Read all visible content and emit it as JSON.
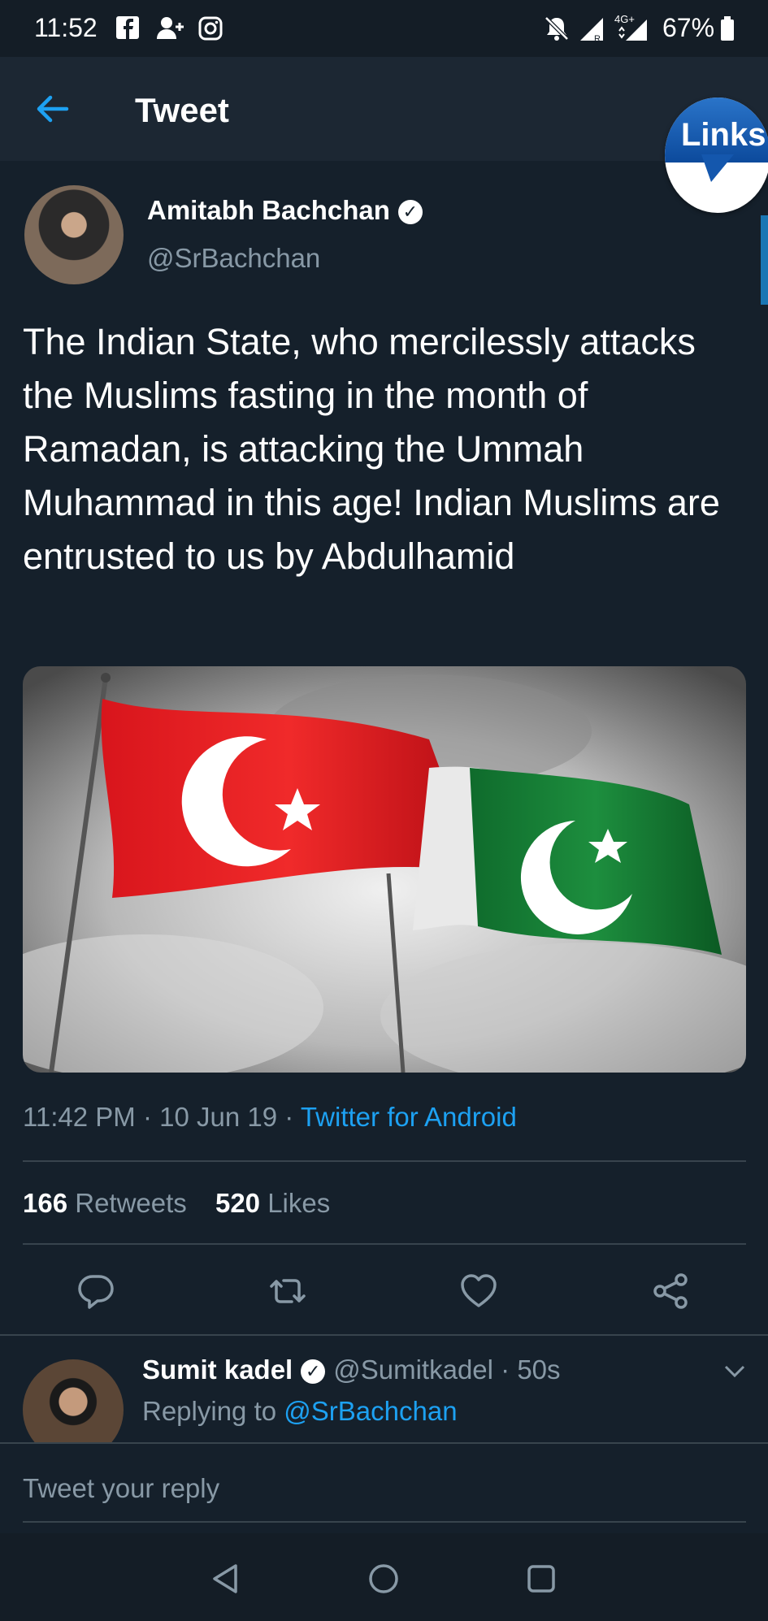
{
  "status_bar": {
    "time": "11:52",
    "network": "4G+",
    "battery": "67%"
  },
  "header": {
    "title": "Tweet",
    "links_badge": "Links"
  },
  "tweet": {
    "author_name": "Amitabh Bachchan",
    "author_handle": "@SrBachchan",
    "text": "The Indian State, who mercilessly attacks the Muslims fasting in the month of Ramadan, is attacking the Ummah Muhammad in this age! Indian Muslims are entrusted to us by Abdulhamid",
    "time": "11:42 PM",
    "date": "10 Jun 19",
    "source": "Twitter for Android",
    "retweets_count": "166",
    "retweets_label": "Retweets",
    "likes_count": "520",
    "likes_label": "Likes"
  },
  "reply": {
    "author_name": "Sumit kadel",
    "author_handle": "@Sumitkadel",
    "age": "50s",
    "replying_prefix": "Replying to",
    "replying_to": "@SrBachchan"
  },
  "compose": {
    "placeholder": "Tweet your reply"
  },
  "colors": {
    "background": "#15202b",
    "accent": "#1da1f2",
    "muted_text": "#8899a6"
  }
}
